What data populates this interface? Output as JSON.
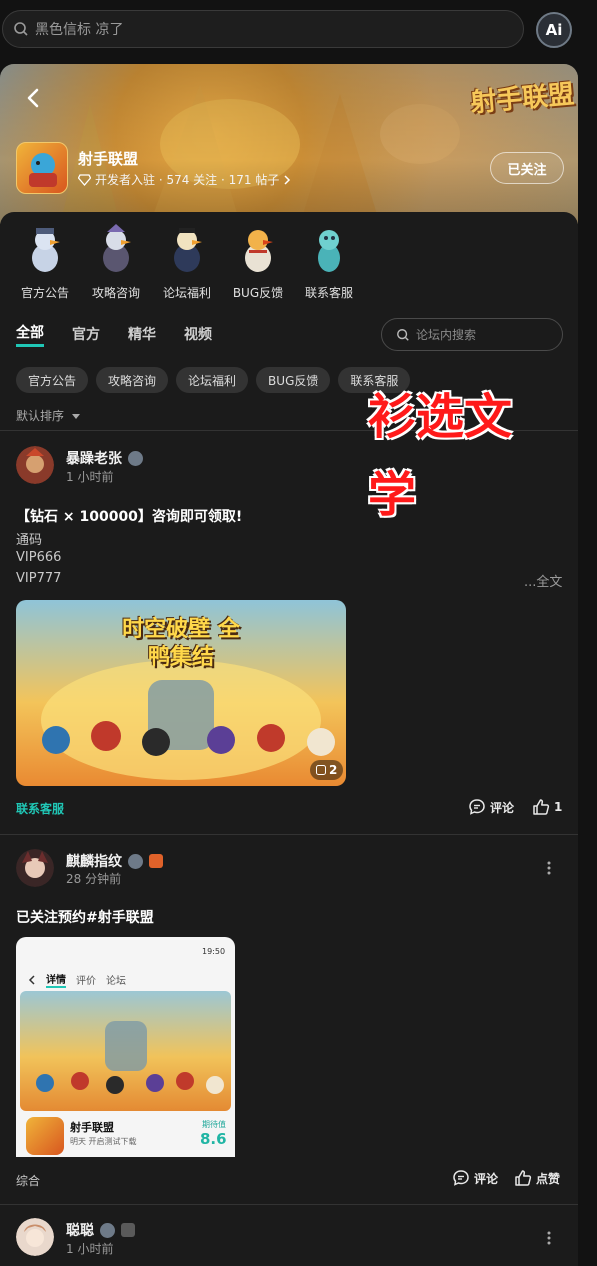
{
  "search": {
    "placeholder": "黑色信标 凉了"
  },
  "ai": {
    "label": "Ai"
  },
  "game": {
    "logo_text": "射手联盟",
    "name": "射手联盟",
    "meta": "开发者入驻 · 574 关注 · 171 帖子",
    "follow_label": "已关注"
  },
  "shortcuts": [
    "官方公告",
    "攻略咨询",
    "论坛福利",
    "BUG反馈",
    "联系客服"
  ],
  "tabs": [
    "全部",
    "官方",
    "精华",
    "视频"
  ],
  "forum_search": {
    "placeholder": "论坛内搜索"
  },
  "chips": [
    "官方公告",
    "攻略咨询",
    "论坛福利",
    "BUG反馈",
    "联系客服"
  ],
  "sort_label": "默认排序",
  "overlay_text": "衫选文学",
  "posts": [
    {
      "user": "暴躁老张",
      "time": "1 小时前",
      "title": "【钻石 × 100000】咨询即可领取!",
      "lines": [
        "通码",
        "VIP666",
        "VIP777"
      ],
      "full_label": "...全文",
      "image_title": "时空破壁 全鸭集结",
      "image_count": "2",
      "tag": "联系客服",
      "comment_label": "评论",
      "like_count": "1"
    },
    {
      "user": "麒麟指纹",
      "time": "28 分钟前",
      "title": "已关注预约#射手联盟",
      "screenshot": {
        "status_time": "19:50",
        "tabs": [
          "详情",
          "评价",
          "论坛"
        ],
        "game_name": "射手联盟",
        "game_sub": "明天 开启测试下载",
        "score_label": "期待值",
        "score": "8.6"
      },
      "tag": "综合",
      "comment_label": "评论",
      "like_label": "点赞"
    },
    {
      "user": "聪聪",
      "time": "1 小时前"
    }
  ],
  "colors": {
    "accent": "#20c7b6",
    "overlay": "#ff1a1a",
    "background": "#1b1b1b"
  }
}
